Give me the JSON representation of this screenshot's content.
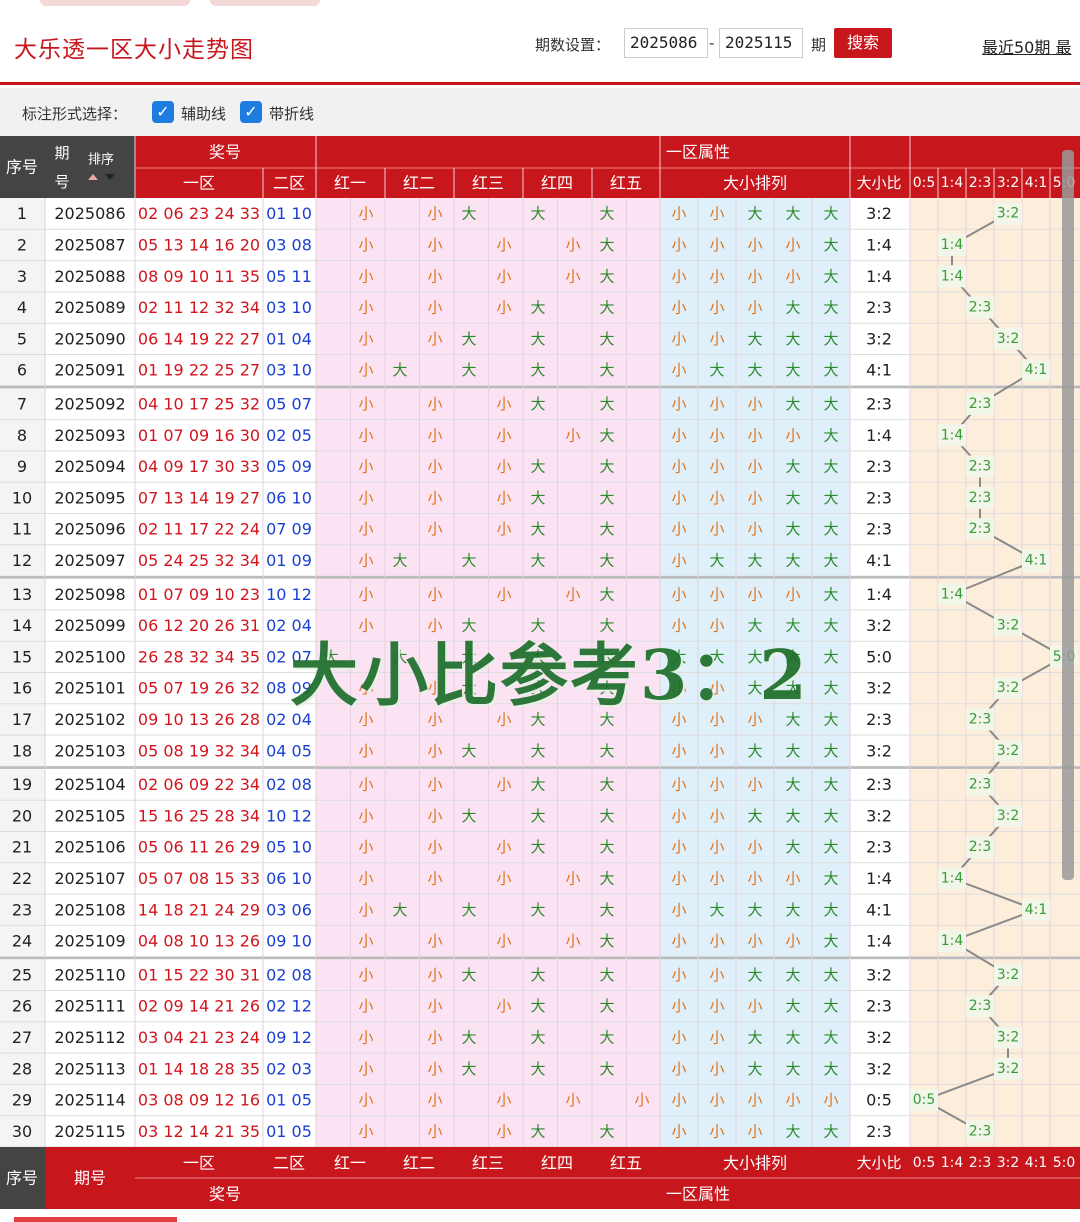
{
  "page": {
    "title": "大乐透一区大小走势图",
    "period_label": "期数设置：",
    "period_from": "2025086",
    "period_sep": "-",
    "period_to": "2025115",
    "period_unit": "期",
    "search_label": "搜索",
    "recent_label": "最近50期",
    "recent_more": "最"
  },
  "options": {
    "label": "标注形式选择：",
    "aux_line": "辅助线",
    "fold_line": "带折线"
  },
  "headers": {
    "seq": "序号",
    "issue": "期号",
    "issue_top": "期",
    "issue_bottom": "号",
    "sort": "排序",
    "award": "奖号",
    "zone1": "一区",
    "zone2": "二区",
    "attr": "一区属性",
    "reds": [
      "红一",
      "红二",
      "红三",
      "红四",
      "红五"
    ],
    "arrange": "大小排列",
    "ratio": "大小比",
    "ratio_cols": [
      "0:5",
      "1:4",
      "2:3",
      "3:2",
      "4:1",
      "5:0"
    ]
  },
  "labels": {
    "big": "大",
    "small": "小"
  },
  "rows": [
    {
      "n": "1",
      "issue": "2025086",
      "z1": "02 06 23 24 33",
      "z2": "01 10",
      "ratio": "3:2"
    },
    {
      "n": "2",
      "issue": "2025087",
      "z1": "05 13 14 16 20",
      "z2": "03 08",
      "ratio": "1:4"
    },
    {
      "n": "3",
      "issue": "2025088",
      "z1": "08 09 10 11 35",
      "z2": "05 11",
      "ratio": "1:4"
    },
    {
      "n": "4",
      "issue": "2025089",
      "z1": "02 11 12 32 34",
      "z2": "03 10",
      "ratio": "2:3"
    },
    {
      "n": "5",
      "issue": "2025090",
      "z1": "06 14 19 22 27",
      "z2": "01 04",
      "ratio": "3:2"
    },
    {
      "n": "6",
      "issue": "2025091",
      "z1": "01 19 22 25 27",
      "z2": "03 10",
      "ratio": "4:1"
    },
    {
      "n": "7",
      "issue": "2025092",
      "z1": "04 10 17 25 32",
      "z2": "05 07",
      "ratio": "2:3"
    },
    {
      "n": "8",
      "issue": "2025093",
      "z1": "01 07 09 16 30",
      "z2": "02 05",
      "ratio": "1:4"
    },
    {
      "n": "9",
      "issue": "2025094",
      "z1": "04 09 17 30 33",
      "z2": "05 09",
      "ratio": "2:3"
    },
    {
      "n": "10",
      "issue": "2025095",
      "z1": "07 13 14 19 27",
      "z2": "06 10",
      "ratio": "2:3"
    },
    {
      "n": "11",
      "issue": "2025096",
      "z1": "02 11 17 22 24",
      "z2": "07 09",
      "ratio": "2:3"
    },
    {
      "n": "12",
      "issue": "2025097",
      "z1": "05 24 25 32 34",
      "z2": "01 09",
      "ratio": "4:1"
    },
    {
      "n": "13",
      "issue": "2025098",
      "z1": "01 07 09 10 23",
      "z2": "10 12",
      "ratio": "1:4"
    },
    {
      "n": "14",
      "issue": "2025099",
      "z1": "06 12 20 26 31",
      "z2": "02 04",
      "ratio": "3:2"
    },
    {
      "n": "15",
      "issue": "2025100",
      "z1": "26 28 32 34 35",
      "z2": "02 07",
      "ratio": "5:0"
    },
    {
      "n": "16",
      "issue": "2025101",
      "z1": "05 07 19 26 32",
      "z2": "08 09",
      "ratio": "3:2"
    },
    {
      "n": "17",
      "issue": "2025102",
      "z1": "09 10 13 26 28",
      "z2": "02 04",
      "ratio": "2:3"
    },
    {
      "n": "18",
      "issue": "2025103",
      "z1": "05 08 19 32 34",
      "z2": "04 05",
      "ratio": "3:2"
    },
    {
      "n": "19",
      "issue": "2025104",
      "z1": "02 06 09 22 34",
      "z2": "02 08",
      "ratio": "2:3"
    },
    {
      "n": "20",
      "issue": "2025105",
      "z1": "15 16 25 28 34",
      "z2": "10 12",
      "ratio": "3:2"
    },
    {
      "n": "21",
      "issue": "2025106",
      "z1": "05 06 11 26 29",
      "z2": "05 10",
      "ratio": "2:3"
    },
    {
      "n": "22",
      "issue": "2025107",
      "z1": "05 07 08 15 33",
      "z2": "06 10",
      "ratio": "1:4"
    },
    {
      "n": "23",
      "issue": "2025108",
      "z1": "14 18 21 24 29",
      "z2": "03 06",
      "ratio": "4:1"
    },
    {
      "n": "24",
      "issue": "2025109",
      "z1": "04 08 10 13 26",
      "z2": "09 10",
      "ratio": "1:4"
    },
    {
      "n": "25",
      "issue": "2025110",
      "z1": "01 15 22 30 31",
      "z2": "02 08",
      "ratio": "3:2"
    },
    {
      "n": "26",
      "issue": "2025111",
      "z1": "02 09 14 21 26",
      "z2": "02 12",
      "ratio": "2:3"
    },
    {
      "n": "27",
      "issue": "2025112",
      "z1": "03 04 21 23 24",
      "z2": "09 12",
      "ratio": "3:2"
    },
    {
      "n": "28",
      "issue": "2025113",
      "z1": "01 14 18 28 35",
      "z2": "02 03",
      "ratio": "3:2"
    },
    {
      "n": "29",
      "issue": "2025114",
      "z1": "03 08 09 12 16",
      "z2": "01 05",
      "ratio": "0:5"
    },
    {
      "n": "30",
      "issue": "2025115",
      "z1": "03 12 14 21 35",
      "z2": "01 05",
      "ratio": "2:3"
    }
  ],
  "watermark": "大小比参考3：2",
  "colors": {
    "header_red": "#c8161d",
    "big": "#2a8a2a",
    "small": "#e0761d",
    "red_zone": "#d4141c",
    "blue_zone": "#1a3fd4"
  }
}
